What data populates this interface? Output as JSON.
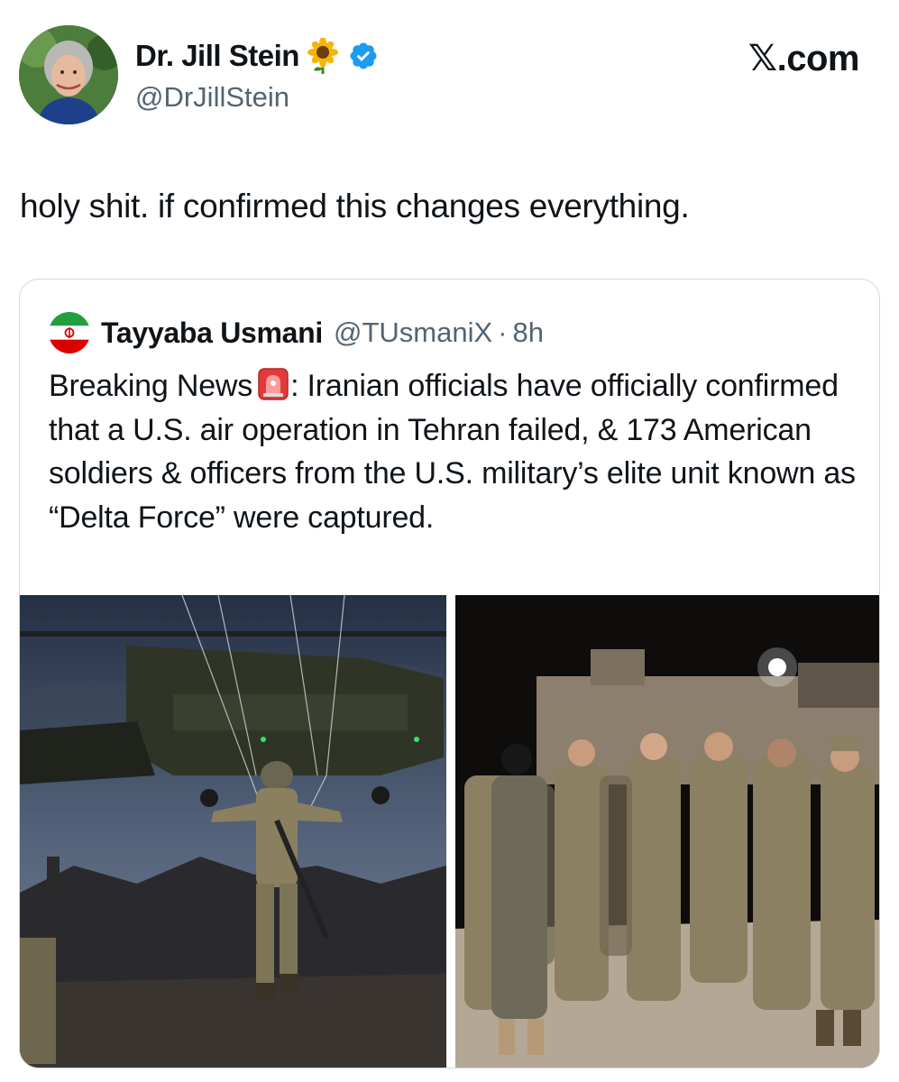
{
  "author": {
    "display_name": "Dr. Jill Stein",
    "name_emoji": "sunflower-emoji",
    "verified_icon": "verified-badge-icon",
    "handle": "@DrJillStein",
    "avatar": "profile-photo"
  },
  "brand": {
    "label": "𝕏.com"
  },
  "post": {
    "text": "holy shit. if confirmed this changes everything."
  },
  "quoted_post": {
    "author_name": "Tayyaba Usmani",
    "author_handle": "@TUsmaniX",
    "separator": "·",
    "time": "8h",
    "avatar": "iran-flag-avatar",
    "text_lead": "Breaking News",
    "text_emoji": "police-siren-emoji",
    "text_body": ": Iranian officials have officially confirmed that a U.S. air operation in Tehran failed, & 173 American soldiers & officers from the U.S. military’s elite unit known as “Delta Force” were captured.",
    "media": [
      {
        "name": "paratrooper-helicopter-photo"
      },
      {
        "name": "captured-soldiers-photo"
      }
    ]
  },
  "colors": {
    "text": "#0f1419",
    "secondary": "#536471",
    "border": "#cfd9de",
    "verified": "#1d9bf0"
  }
}
